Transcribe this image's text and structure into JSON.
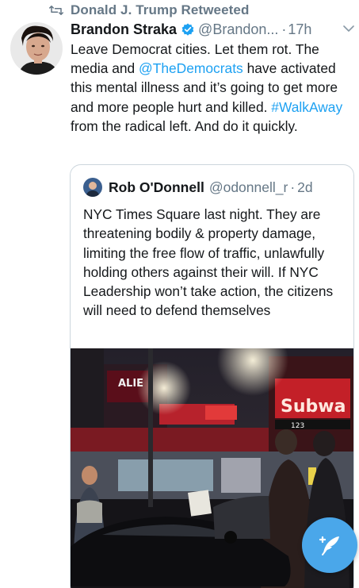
{
  "retweet_banner": {
    "text": "Donald J. Trump Retweeted"
  },
  "tweet": {
    "author_name": "Brandon Straka",
    "author_handle": "@Brandon...",
    "time": "17h",
    "text_parts": [
      "Leave Democrat cities. Let them rot. The media and ",
      "@TheDemocrats",
      " have activated this mental illness and it’s going to get more and more people hurt and killed. ",
      "#WalkAway",
      " from the radical left. And do it quickly."
    ]
  },
  "quoted_tweet": {
    "author_name": "Rob O'Donnell",
    "author_handle": "@odonnell_r",
    "time": "2d",
    "text": "NYC Times Square last night. They are threatening bodily & property damage, limiting the free flow of traffic, unlawfully holding others against their will. If NYC Leadership won’t take action, the citizens will need to defend themselves",
    "media": {
      "sign_texts": [
        "ALIE",
        "Subwa",
        "123"
      ]
    }
  },
  "colors": {
    "link": "#1da1f2",
    "secondary_text": "#657786",
    "fab": "#4aa7ea",
    "verified": "#1da1f2"
  },
  "icons": {
    "retweet": "retweet-icon",
    "verified": "verified-badge-icon",
    "chevron": "chevron-down-icon",
    "fab": "compose-feather-icon"
  }
}
